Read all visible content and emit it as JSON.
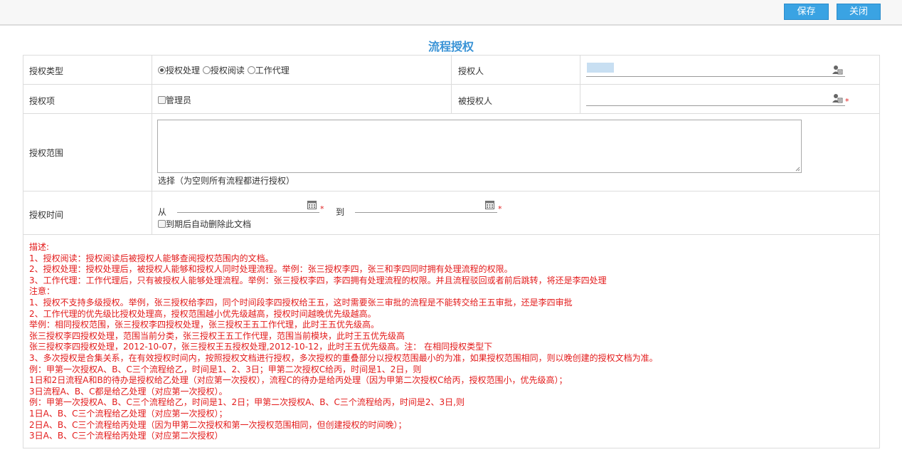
{
  "toolbar": {
    "save_label": "保存",
    "close_label": "关闭"
  },
  "page_title": "流程授权",
  "form": {
    "auth_type": {
      "label": "授权类型",
      "options": [
        "授权处理",
        "授权阅读",
        "工作代理"
      ],
      "selected": "授权处理"
    },
    "grantor": {
      "label": "授权人"
    },
    "auth_item": {
      "label": "授权项",
      "checkbox_label": "管理员"
    },
    "grantee": {
      "label": "被授权人"
    },
    "auth_scope": {
      "label": "授权范围",
      "hint": "选择（为空则所有流程都进行授权）"
    },
    "auth_time": {
      "label": "授权时间",
      "from_label": "从",
      "to_label": "到",
      "auto_delete_label": "到期后自动删除此文档"
    }
  },
  "description": [
    "描述:",
    "1、授权阅读：授权阅读后被授权人能够查阅授权范围内的文档。",
    "2、授权处理：授权处理后，被授权人能够和授权人同时处理流程。举例：张三授权李四，张三和李四同时拥有处理流程的权限。",
    "3、工作代理：工作代理后，只有被授权人能够处理流程。举例：张三授权李四，李四拥有处理流程的权限。并且流程驳回或者前后跳转，将还是李四处理",
    "注意：",
    "1、授权不支持多级授权。举例，张三授权给李四，同个时间段李四授权给王五，这时需要张三审批的流程是不能转交给王五审批，还是李四审批",
    "2、工作代理的优先级比授权处理高，授权范围越小优先级越高，授权时间越晚优先级越高。",
    "举例：相同授权范围，张三授权李四授权处理，张三授权王五工作代理，此时王五优先级高。",
    "张三授权李四授权处理，范围当前分类，张三授权王五工作代理，范围当前模块，此时王五优先级高",
    "张三授权李四授权处理，2012-10-07，张三授权王五授权处理,2012-10-12，此时王五优先级高。注：  在相同授权类型下",
    "3、多次授权是合集关系，在有效授权时间内，按照授权文档进行授权，多次授权的重叠部分以授权范围最小的为准，如果授权范围相同，则以晚创建的授权文档为准。",
    "例：甲第一次授权A、B、C三个流程给乙，时间是1、2、3日；甲第二次授权C给丙，时间是1、2日，则",
    "1日和2日流程A和B的待办是授权给乙处理（对应第一次授权），流程C的待办是给丙处理（因为甲第二次授权C给丙，授权范围小，优先级高）；",
    "3日流程A、B、C都是给乙处理（对应第一次授权）。",
    "例：甲第一次授权A、B、C三个流程给乙，时间是1、2日；甲第二次授权A、B、C三个流程给丙，时间是2、3日,则",
    "1日A、B、C三个流程给乙处理（对应第一次授权）；",
    "2日A、B、C三个流程给丙处理（因为甲第二次授权和第一次授权范围相同，但创建授权的时间晚）；",
    "3日A、B、C三个流程给丙处理（对应第二次授权）"
  ],
  "colors": {
    "accent": "#3aa3e3",
    "title": "#3a93d6",
    "warning_text": "#e31a1a",
    "required": "#e02020"
  },
  "icons": {
    "user_picker": "user-select-icon",
    "date_picker": "calendar-icon"
  }
}
